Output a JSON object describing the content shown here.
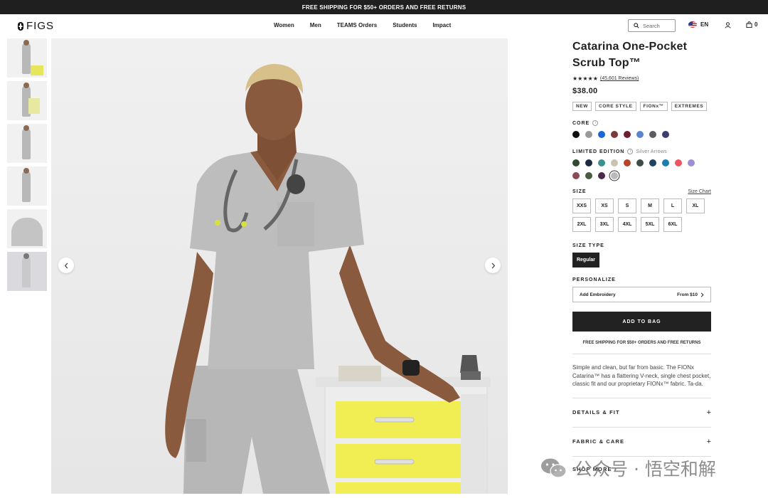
{
  "promo": {
    "text": "FREE SHIPPING FOR $50+ ORDERS AND FREE RETURNS"
  },
  "header": {
    "logo": "FIGS",
    "nav": [
      "Women",
      "Men",
      "TEAMS Orders",
      "Students",
      "Impact"
    ],
    "search_placeholder": "Search",
    "language": "EN",
    "bag_count": "0"
  },
  "gallery": {
    "thumbnail_count": 6,
    "selected_thumbnail": 6
  },
  "product": {
    "title": "Catarina One-Pocket Scrub Top™",
    "stars": "★★★★★",
    "reviews": "(45,601 Reviews)",
    "price": "$38.00",
    "tags": [
      "NEW",
      "CORE STYLE",
      "FIONx™",
      "EXTREMES"
    ],
    "core_label": "CORE",
    "core_colors": [
      "#111111",
      "#9a9a9a",
      "#1a66d6",
      "#7a3a3a",
      "#6b2230",
      "#5b84cf",
      "#5c5c62",
      "#3d3f72"
    ],
    "limited_label": "LIMITED EDITION",
    "limited_selected": "Silver Arrows",
    "limited_colors": [
      "#2f4a2c",
      "#1d2a44",
      "#3c8f8f",
      "#c9c3b5",
      "#b5442a",
      "#3d4d45",
      "#1e4460",
      "#1a7fad",
      "#ee5560",
      "#9d8fd2",
      "#8a4b56",
      "#4b5a43",
      "#4b2a4a",
      "#b9b9b9"
    ],
    "size_label": "SIZE",
    "size_chart": "Size Chart",
    "sizes": [
      "XXS",
      "XS",
      "S",
      "M",
      "L",
      "XL",
      "2XL",
      "3XL",
      "4XL",
      "5XL",
      "6XL"
    ],
    "size_type_label": "SIZE TYPE",
    "size_type": "Regular",
    "personalize_label": "PERSONALIZE",
    "embroidery": "Add Embroidery",
    "embroidery_price": "From $10",
    "add_to_bag": "ADD TO BAG",
    "shipping_note": "FREE SHIPPING FOR $50+ ORDERS AND FREE RETURNS",
    "description": "Simple and clean, but far from basic. The FIONx Catarina™ has a flattering V-neck, single chest pocket, classic fit and our proprietary FIONx™ fabric. Ta-da.",
    "accordions": [
      "DETAILS & FIT",
      "FABRIC & CARE",
      "SHOP MORE"
    ]
  },
  "watermark": {
    "text": "公众号 · 悟空和解"
  }
}
